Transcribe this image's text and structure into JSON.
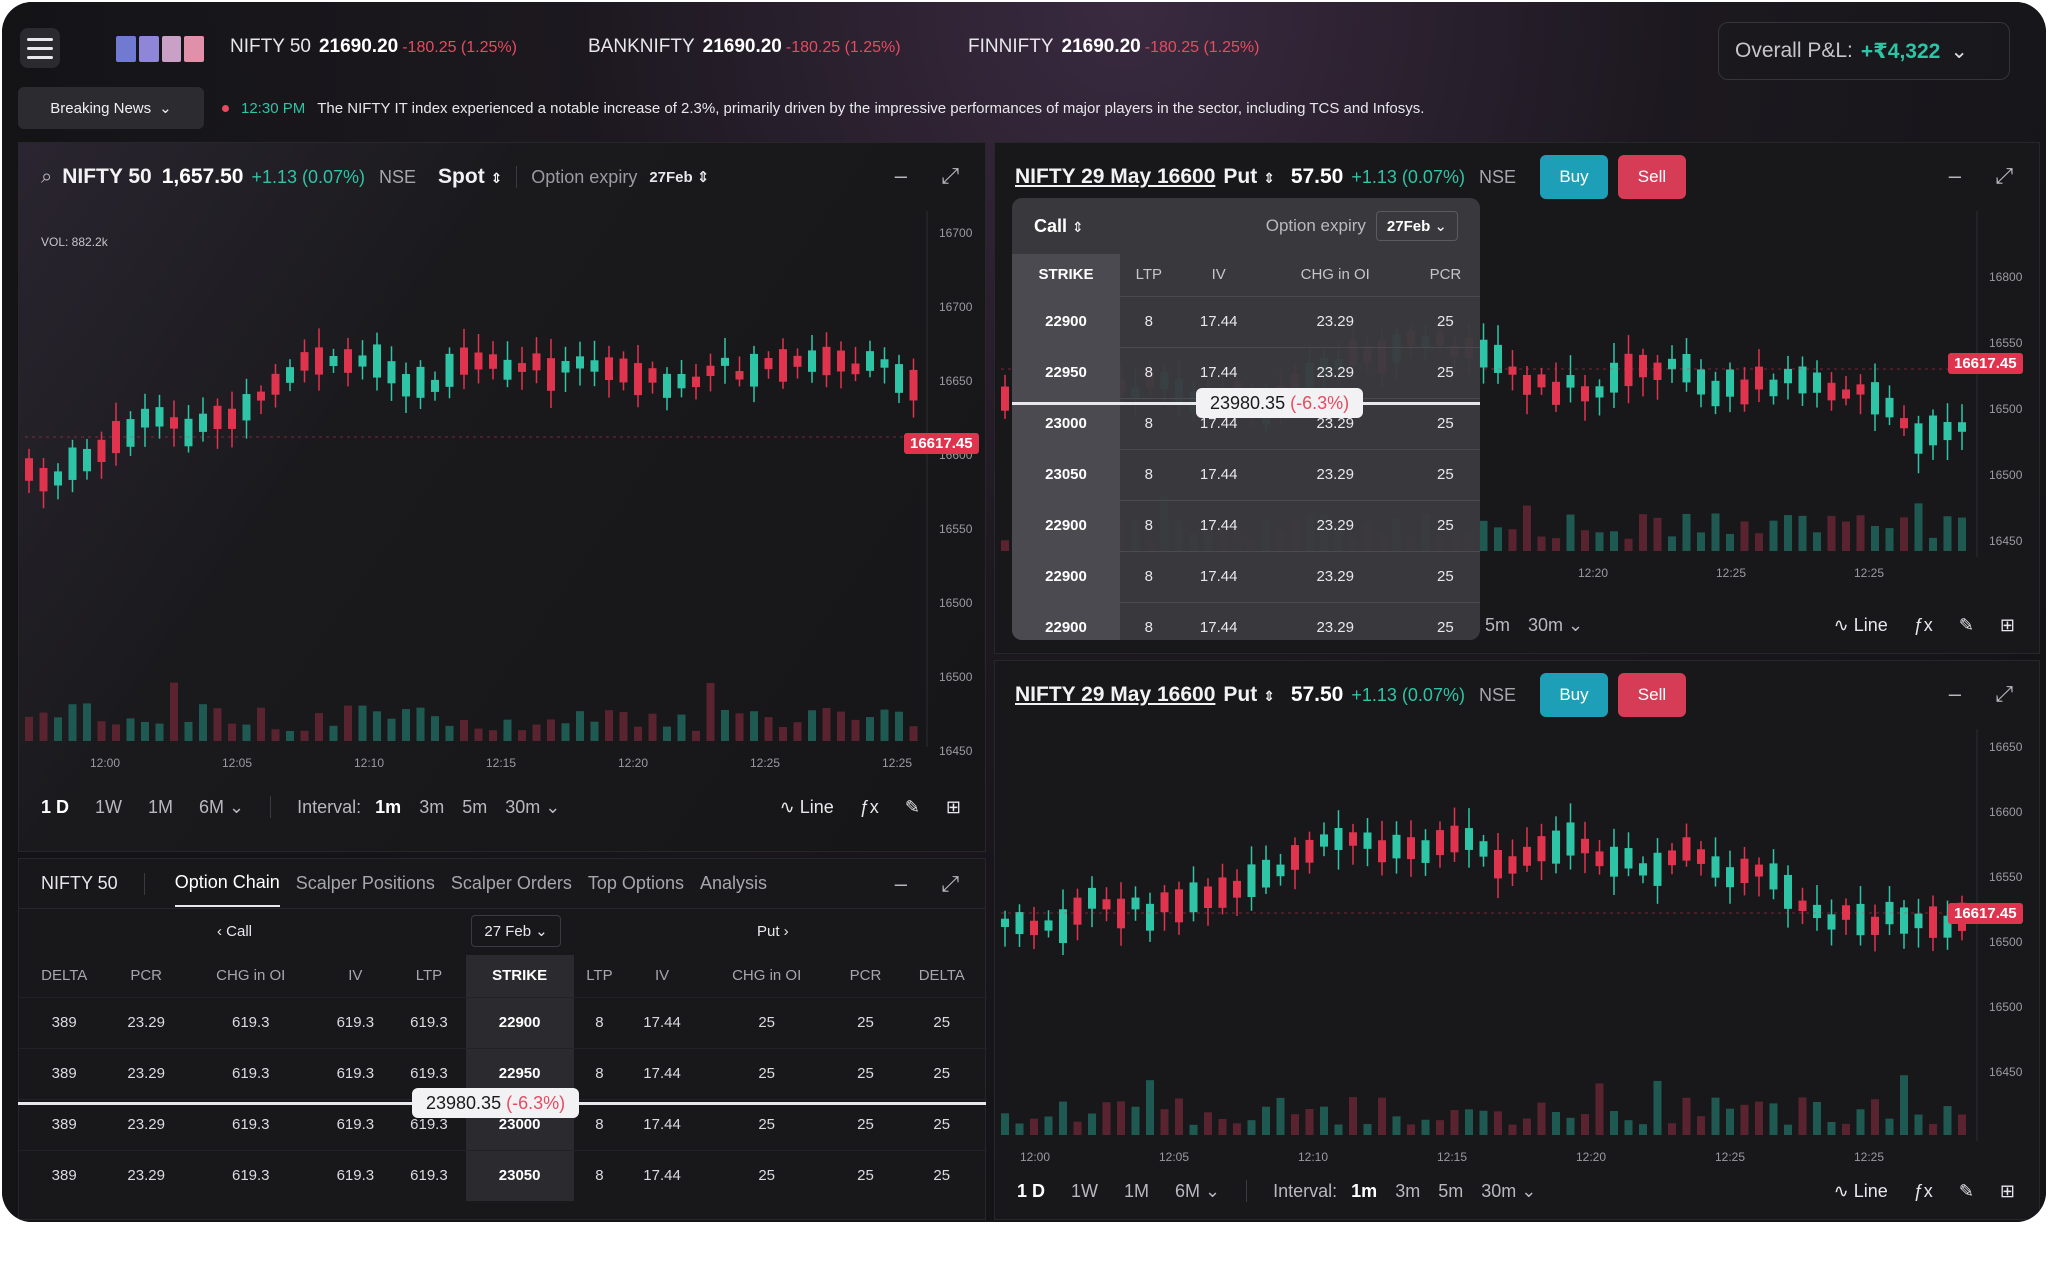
{
  "header": {
    "tickers": [
      {
        "name": "NIFTY 50",
        "price": "21690.20",
        "change": "-180.25 (1.25%)"
      },
      {
        "name": "BANKNIFTY",
        "price": "21690.20",
        "change": "-180.25 (1.25%)"
      },
      {
        "name": "FINNIFTY",
        "price": "21690.20",
        "change": "-180.25 (1.25%)"
      }
    ],
    "pnl_label": "Overall P&L:",
    "pnl_value": "+₹4,322"
  },
  "news": {
    "button": "Breaking News",
    "time": "12:30 PM",
    "text": "The NIFTY IT index experienced a notable increase of 2.3%, primarily driven by the impressive performances of major players in the sector, including TCS and Infosys."
  },
  "main_chart": {
    "symbol": "NIFTY 50",
    "price": "1,657.50",
    "change": "+1.13 (0.07%)",
    "exchange": "NSE",
    "mode": "Spot",
    "option_expiry_label": "Option expiry",
    "option_expiry": "27Feb",
    "vol": "VOL: 882.2k",
    "last_price_tag": "16617.45",
    "y_ticks": [
      "16700",
      "16700",
      "16650",
      "16600",
      "16550",
      "16500",
      "16500",
      "16450"
    ],
    "x_ticks": [
      "12:00",
      "12:05",
      "12:10",
      "12:15",
      "12:20",
      "12:25",
      "12:25"
    ]
  },
  "toolbar": {
    "ranges": [
      "1 D",
      "1W",
      "1M",
      "6M"
    ],
    "interval_label": "Interval:",
    "intervals": [
      "1m",
      "3m",
      "5m",
      "30m"
    ],
    "line_label": "Line"
  },
  "option_chain": {
    "symbol": "NIFTY 50",
    "tabs": [
      "Option Chain",
      "Scalper Positions",
      "Scalper Orders",
      "Top Options",
      "Analysis"
    ],
    "call_label": "Call",
    "put_label": "Put",
    "expiry": "27 Feb",
    "columns": [
      "DELTA",
      "PCR",
      "CHG in OI",
      "IV",
      "LTP",
      "STRIKE",
      "LTP",
      "IV",
      "CHG in OI",
      "PCR",
      "DELTA"
    ],
    "rows": [
      [
        "389",
        "23.29",
        "619.3",
        "619.3",
        "619.3",
        "22900",
        "8",
        "17.44",
        "25",
        "25",
        "25"
      ],
      [
        "389",
        "23.29",
        "619.3",
        "619.3",
        "619.3",
        "22950",
        "8",
        "17.44",
        "25",
        "25",
        "25"
      ],
      [
        "389",
        "23.29",
        "619.3",
        "619.3",
        "619.3",
        "23000",
        "8",
        "17.44",
        "25",
        "25",
        "25"
      ],
      [
        "389",
        "23.29",
        "619.3",
        "619.3",
        "619.3",
        "23050",
        "8",
        "17.44",
        "25",
        "25",
        "25"
      ]
    ],
    "highlight_price": "23980.35",
    "highlight_change": "(-6.3%)"
  },
  "right_top": {
    "symbol": "NIFTY 29 May 16600",
    "type": "Put",
    "price": "57.50",
    "change": "+1.13 (0.07%)",
    "exchange": "NSE",
    "buy": "Buy",
    "sell": "Sell",
    "last_price_tag": "16617.45",
    "y_ticks": [
      "16800",
      "16550",
      "16500",
      "16500",
      "16450"
    ],
    "x_ticks": [
      "12:20",
      "12:25",
      "12:25"
    ],
    "popover": {
      "type": "Call",
      "expiry_label": "Option expiry",
      "expiry": "27Feb",
      "columns": [
        "STRIKE",
        "LTP",
        "IV",
        "CHG in OI",
        "PCR"
      ],
      "rows": [
        [
          "22900",
          "8",
          "17.44",
          "23.29",
          "25"
        ],
        [
          "22950",
          "8",
          "17.44",
          "23.29",
          "25"
        ],
        [
          "23000",
          "8",
          "17.44",
          "23.29",
          "25"
        ],
        [
          "23050",
          "8",
          "17.44",
          "23.29",
          "25"
        ],
        [
          "22900",
          "8",
          "17.44",
          "23.29",
          "25"
        ],
        [
          "22900",
          "8",
          "17.44",
          "23.29",
          "25"
        ],
        [
          "22900",
          "8",
          "17.44",
          "23.29",
          "25"
        ]
      ],
      "highlight_price": "23980.35",
      "highlight_change": "(-6.3%)"
    },
    "toolbar_intervals": [
      "5m",
      "30m"
    ]
  },
  "right_bottom": {
    "symbol": "NIFTY 29 May 16600",
    "type": "Put",
    "price": "57.50",
    "change": "+1.13 (0.07%)",
    "exchange": "NSE",
    "buy": "Buy",
    "sell": "Sell",
    "last_price_tag": "16617.45",
    "y_ticks": [
      "16650",
      "16600",
      "16550",
      "16500",
      "16500",
      "16450"
    ],
    "x_ticks": [
      "12:00",
      "12:05",
      "12:10",
      "12:15",
      "12:20",
      "12:25",
      "12:25"
    ]
  },
  "colors": {
    "up": "#2ec4a6",
    "down": "#e0334e",
    "accent_buy": "#1e9fb8"
  }
}
